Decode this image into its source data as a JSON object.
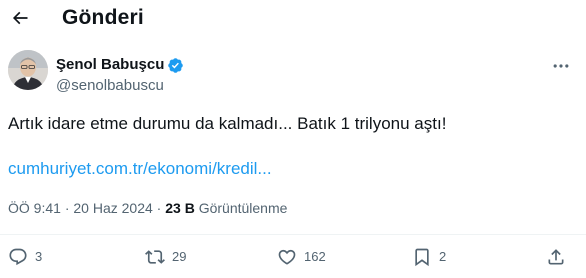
{
  "header": {
    "title": "Gönderi"
  },
  "author": {
    "display_name": "Şenol Babuşcu",
    "handle": "@senolbabuscu",
    "verified": true
  },
  "tweet": {
    "text": "Artık idare etme durumu da kalmadı... Batık 1 trilyonu aştı!",
    "link_text": "cumhuriyet.com.tr/ekonomi/kredil..."
  },
  "meta": {
    "time": "ÖÖ 9:41",
    "separator": "·",
    "date": "20 Haz 2024",
    "views_count": "23 B",
    "views_label": "Görüntülenme"
  },
  "actions": {
    "replies": "3",
    "reposts": "29",
    "likes": "162",
    "bookmarks": "2"
  },
  "colors": {
    "accent": "#1d9bf0",
    "text_primary": "#0f1419",
    "text_secondary": "#536471",
    "divider": "#eff3f4"
  }
}
